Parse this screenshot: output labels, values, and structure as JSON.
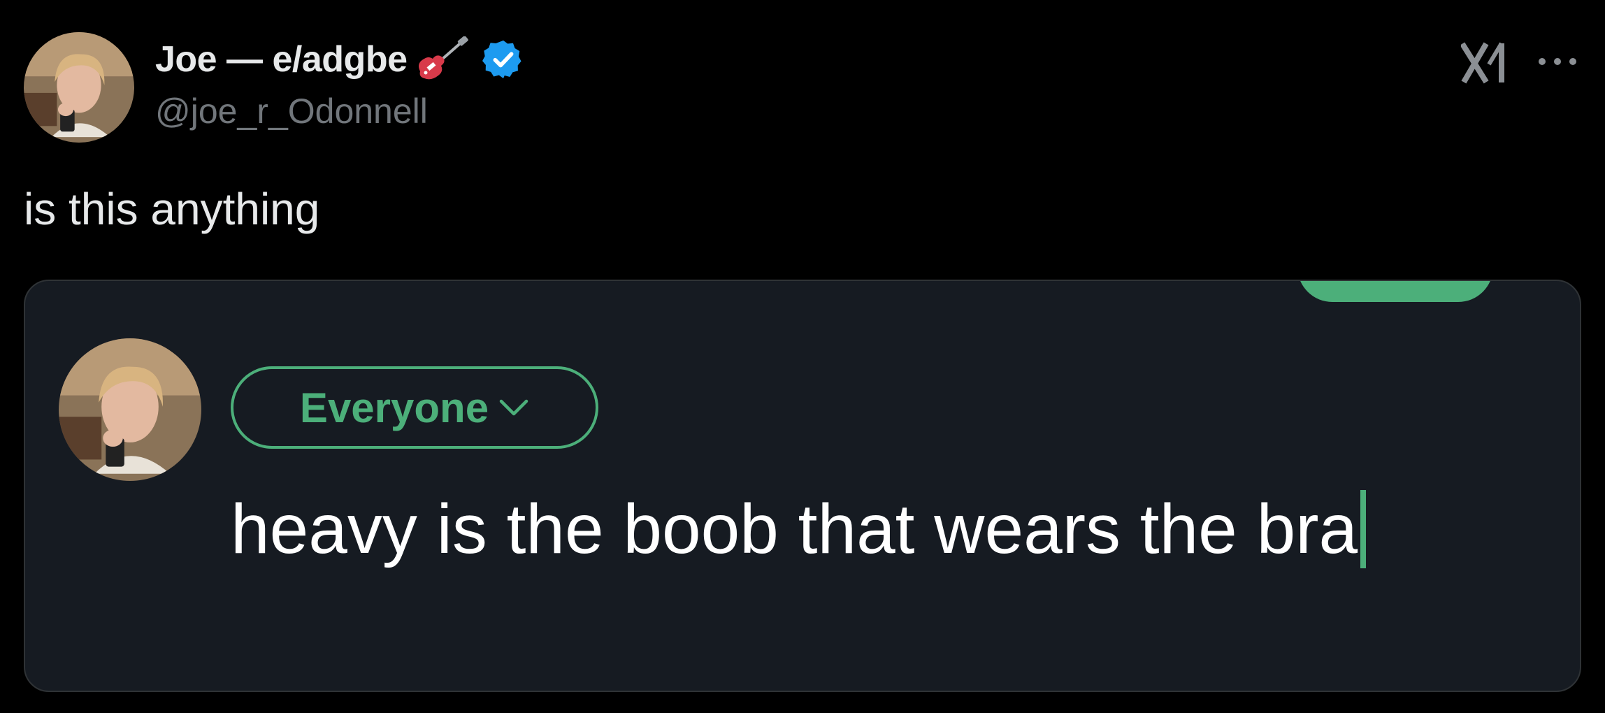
{
  "tweet": {
    "author": {
      "display_name": "Joe — e/adgbe",
      "handle": "@joe_r_Odonnell",
      "avatar_icon": "profile-photo",
      "badge_icons": [
        "electric-guitar-icon",
        "verified-badge-icon"
      ]
    },
    "header_icons": [
      "grok-icon",
      "more-options-icon"
    ],
    "text": "is this anything"
  },
  "media": {
    "compose_screenshot": {
      "audience_label": "Everyone",
      "audience_icon": "chevron-down-icon",
      "draft_text": "heavy is the boob that wears the bra",
      "accent_color": "#4caf7a",
      "background_color": "#161b22"
    }
  },
  "colors": {
    "background": "#000000",
    "primary_text": "#e7e9ea",
    "secondary_text": "#71767b",
    "verified_blue": "#1d9bf0"
  }
}
